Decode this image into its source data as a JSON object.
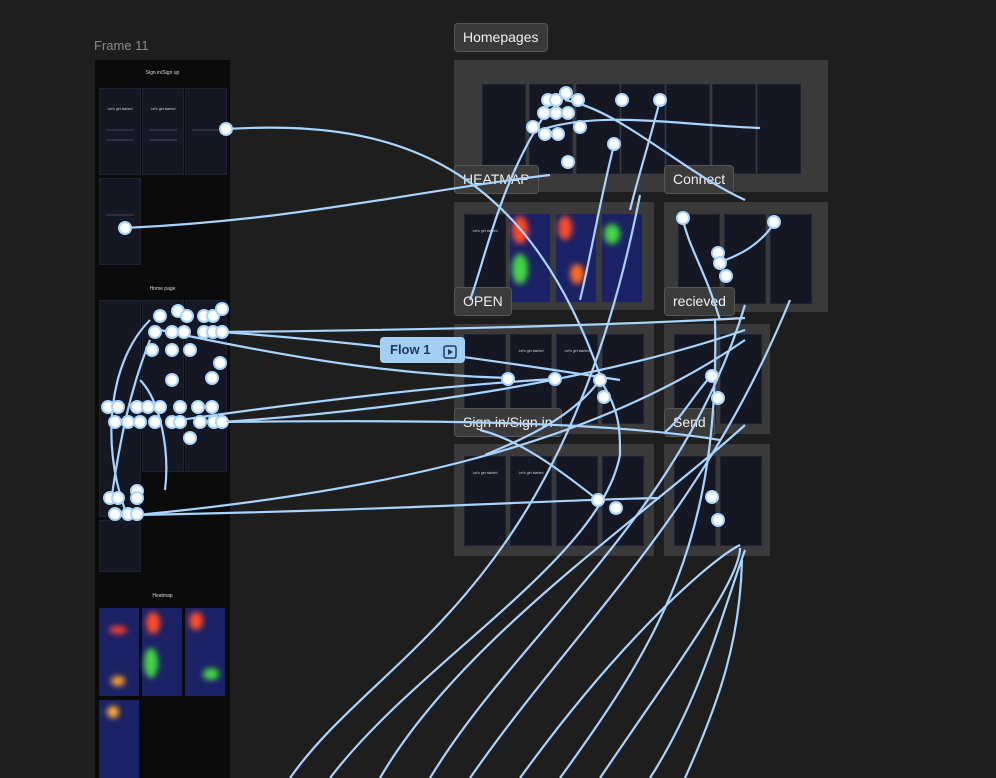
{
  "canvas": {
    "frame_label": "Frame 11",
    "left_frame": {
      "signin_title": "Sign in/Sign up",
      "homepage_title": "Home page",
      "heatmap_title": "Heatmap",
      "screen_text": "Let's get started"
    },
    "sections": {
      "homepages": "Homepages",
      "heatmap": "HEATMAP",
      "connect": "Connect",
      "open": "OPEN",
      "recieved": "recieved",
      "signin": "Sign in/Sign in",
      "send": "Send"
    },
    "flow_badge": "Flow 1"
  },
  "colors": {
    "wire": "#a8d4ff",
    "canvas": "#1e1e1e",
    "section": "#3a3a3a"
  }
}
